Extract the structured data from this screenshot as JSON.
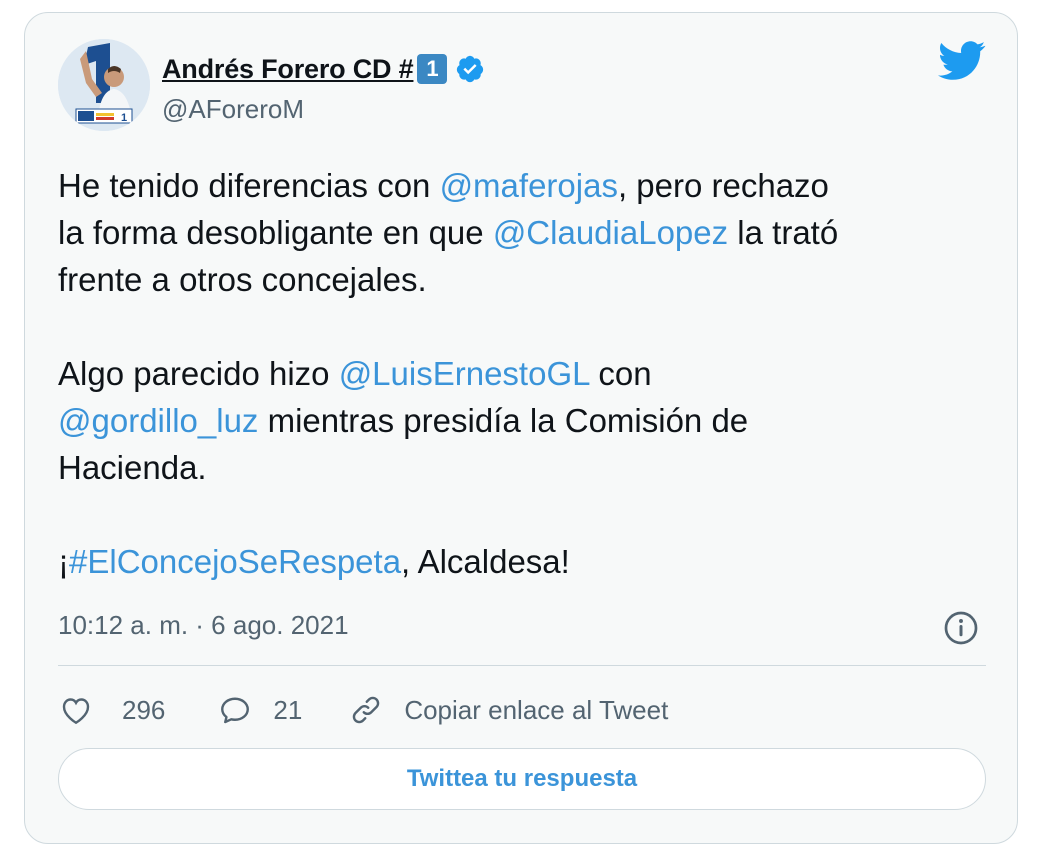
{
  "author": {
    "name": "Andrés Forero CD #",
    "name_keycap": "1",
    "handle": "@AForeroM",
    "avatar_logo_text": "1"
  },
  "tweet": {
    "line1_pre": "He tenido diferencias con ",
    "line1_mention": "@maferojas",
    "line1_post": ", pero rechazo",
    "line2_pre": "la forma desobligante en que ",
    "line2_mention": "@ClaudiaLopez",
    "line2_post": " la trató",
    "line3": "frente a otros concejales.",
    "line4_pre": "Algo parecido hizo ",
    "line4_mention": "@LuisErnestoGL",
    "line4_post": " con",
    "line5_mention": "@gordillo_luz",
    "line5_post": " mientras presidía la Comisión de",
    "line6": "Hacienda.",
    "line7_pre": "¡",
    "line7_hashtag": "#ElConcejoSeRespeta",
    "line7_post": ", Alcaldesa!"
  },
  "meta": {
    "timestamp": "10:12 a. m. · 6 ago. 2021"
  },
  "actions": {
    "likes": "296",
    "replies": "21",
    "copy_link": "Copiar enlace al Tweet"
  },
  "reply_button": "Twittea tu respuesta",
  "colors": {
    "link": "#3b94d9",
    "twitter_blue": "#1d9bf0",
    "muted": "#536471"
  },
  "icons": [
    "verified-badge-icon",
    "twitter-bird-icon",
    "info-icon",
    "heart-icon",
    "reply-bubble-icon",
    "link-icon"
  ]
}
